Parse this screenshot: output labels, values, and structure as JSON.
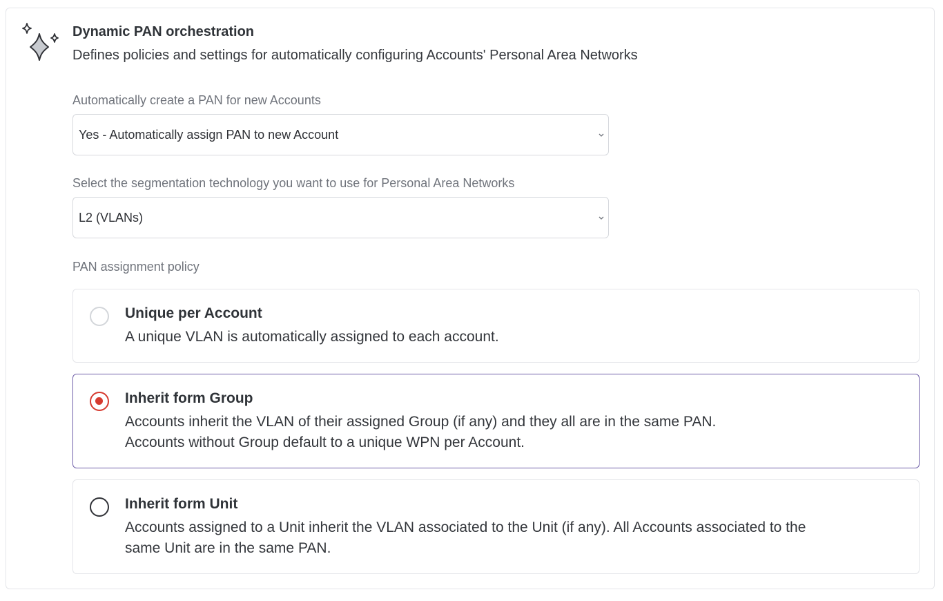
{
  "section": {
    "icon": "sparkles-icon",
    "title": "Dynamic PAN orchestration",
    "subtitle": "Defines policies and settings for automatically configuring Accounts' Personal Area Networks"
  },
  "auto_create": {
    "label": "Automatically create a PAN for new Accounts",
    "selected": "Yes - Automatically assign PAN to new Account"
  },
  "segmentation": {
    "label": "Select the segmentation technology you want to use for Personal Area Networks",
    "selected": "L2 (VLANs)"
  },
  "policy": {
    "label": "PAN assignment policy",
    "selected_option": "Inherit form Group",
    "options": [
      {
        "title": "Unique per Account",
        "desc_lines": [
          "A unique VLAN is automatically assigned to each account."
        ]
      },
      {
        "title": "Inherit form Group",
        "desc_lines": [
          "Accounts inherit the VLAN of their assigned Group (if any) and they all are in the same PAN.",
          "Accounts without Group default to a unique WPN per Account."
        ]
      },
      {
        "title": "Inherit form Unit",
        "desc_lines": [
          "Accounts assigned to a Unit inherit the  VLAN associated to the Unit (if any). All Accounts associated to the",
          "same Unit are in the same PAN."
        ]
      }
    ]
  },
  "colors": {
    "accent_radio": "#d63a2f",
    "selected_border": "#6e5ea8"
  }
}
